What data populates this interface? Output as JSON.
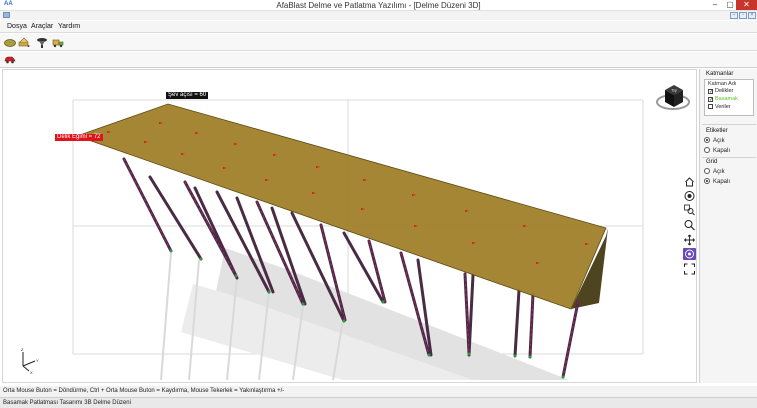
{
  "window": {
    "app_logo": "AA",
    "title": "AfaBlast Delme ve Patlatma Yazılımı - [Delme Düzeni 3D]",
    "minimize": "–",
    "maximize": "▢",
    "close": "✕"
  },
  "mdi": {
    "minimize": "–",
    "restore": "▫",
    "close": "×"
  },
  "menu": {
    "items": [
      "Dosya",
      "Araçlar",
      "Yardım"
    ]
  },
  "toolbar": {
    "icons": [
      "bench-layout-icon",
      "drill-plan-icon",
      "blast-icon",
      "loading-truck-icon"
    ],
    "secondary_icons": [
      "car-icon"
    ]
  },
  "viewport": {
    "dip_label": "Delik Eğimi = 72",
    "angle_label": "Şev açısı = 60",
    "viewcube_face": "Top",
    "bench_color": "#a0802a",
    "hole_color": "#5a2a4a",
    "marker_color": "#e0121a",
    "toe_marker_color": "#2a9a3a"
  },
  "nav_tools": [
    "home-icon",
    "look-icon",
    "zoom-window-icon",
    "zoom-icon",
    "pan-icon",
    "orbit-icon",
    "fullscreen-icon"
  ],
  "layers": {
    "title": "Katmanlar",
    "header": "Katman Adı",
    "items": [
      {
        "label": "Delikler",
        "checked": true,
        "color": "#222222"
      },
      {
        "label": "Basamak",
        "checked": true,
        "color": "#5fbf2f"
      },
      {
        "label": "Veriler",
        "checked": false,
        "color": "#222222"
      }
    ]
  },
  "labels_group": {
    "title": "Etiketler",
    "options": [
      "Açık",
      "Kapalı"
    ],
    "selected": "Açık"
  },
  "grid_group": {
    "title": "Grid",
    "options": [
      "Açık",
      "Kapalı"
    ],
    "selected": "Kapalı"
  },
  "hint": "Orta Mouse Buton = Döndürme, Ctrl + Orta Mouse Buton = Kaydırma, Mouse Tekerlek = Yakınlaştırma +/-",
  "status": "Basamak Patlatması Tasarımı 3B Delme Düzeni"
}
